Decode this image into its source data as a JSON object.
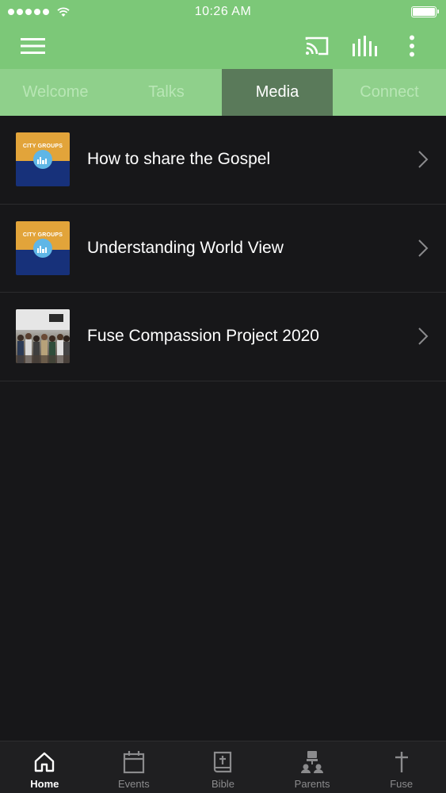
{
  "status_bar": {
    "time": "10:26 AM"
  },
  "toolbar": {
    "menu_icon": "hamburger-menu-icon",
    "cast_icon": "cast-icon",
    "equalizer_icon": "equalizer-icon",
    "more_icon": "more-vertical-icon"
  },
  "tabs": [
    {
      "label": "Welcome",
      "active": false
    },
    {
      "label": "Talks",
      "active": false
    },
    {
      "label": "Media",
      "active": true
    },
    {
      "label": "Connect",
      "active": false
    }
  ],
  "thumbnail_text": {
    "city_groups": "CITY GROUPS"
  },
  "media_items": [
    {
      "title": "How to share the Gospel",
      "thumbnail": "city-groups"
    },
    {
      "title": "Understanding World View",
      "thumbnail": "city-groups"
    },
    {
      "title": "Fuse Compassion Project 2020",
      "thumbnail": "group-photo"
    }
  ],
  "bottom_nav": [
    {
      "label": "Home",
      "icon": "home-icon",
      "active": true
    },
    {
      "label": "Events",
      "icon": "calendar-icon",
      "active": false
    },
    {
      "label": "Bible",
      "icon": "bible-icon",
      "active": false
    },
    {
      "label": "Parents",
      "icon": "parents-icon",
      "active": false
    },
    {
      "label": "Fuse",
      "icon": "cross-icon",
      "active": false
    }
  ],
  "colors": {
    "header_green": "#7cc878",
    "tab_bar_green": "#8fd08b",
    "active_tab": "#5a7a5a",
    "background": "#171719",
    "nav_background": "#1f1f21"
  }
}
